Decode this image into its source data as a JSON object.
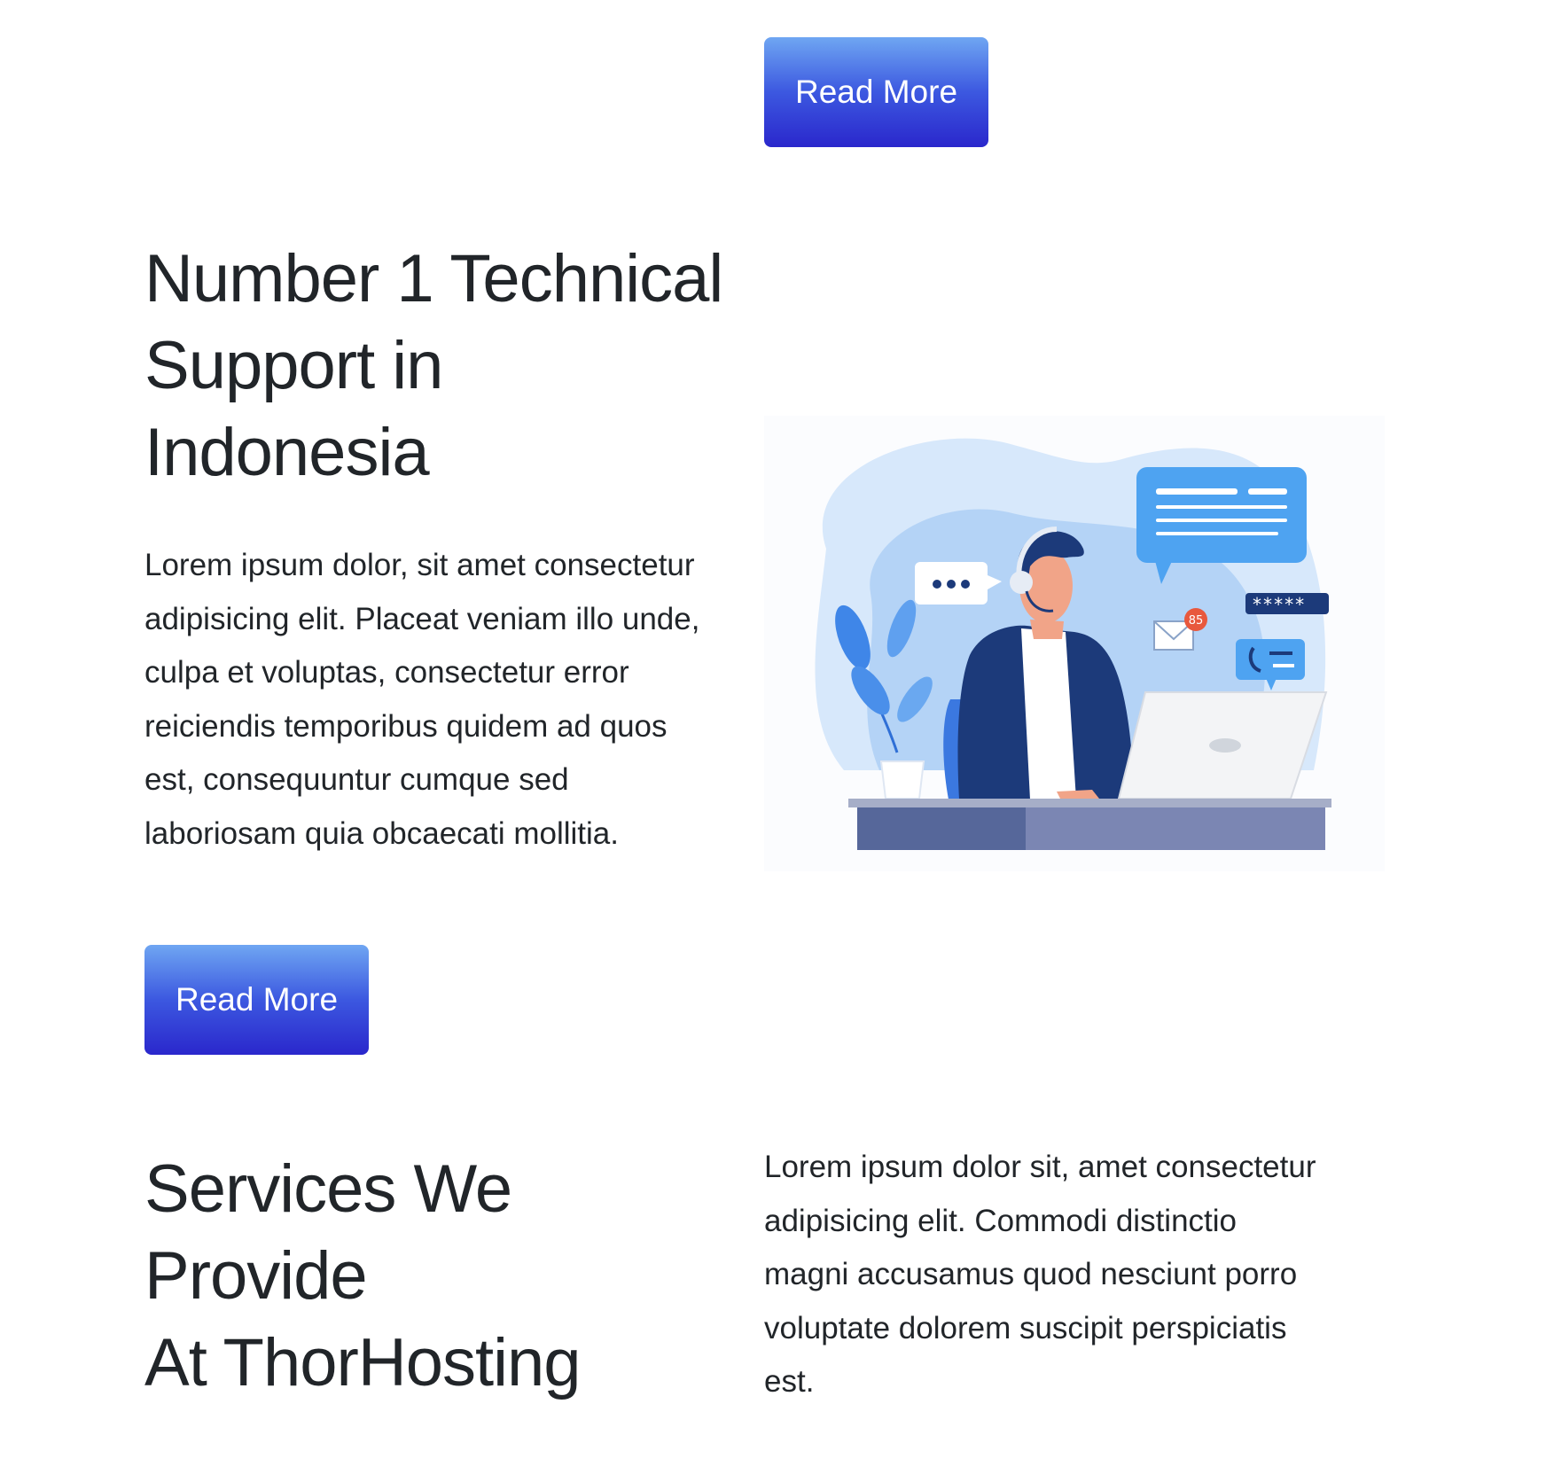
{
  "top_cta": {
    "label": "Read More"
  },
  "hero": {
    "title_lines": [
      "Number 1 Technical",
      "Support in",
      "Indonesia"
    ],
    "body_lines": [
      "Lorem ipsum dolor, sit amet consectetur",
      "adipisicing elit. Placeat veniam illo unde,",
      "culpa et voluptas, consectetur error",
      "reiciendis temporibus quidem ad quos",
      "est, consequuntur cumque sed",
      "laboriosam quia obcaecati mollitia."
    ],
    "cta_label": "Read More",
    "illustration": {
      "icon": "customer-support-agent-illustration",
      "badge_count": "85",
      "password_mask": "*****"
    }
  },
  "services": {
    "title_lines": [
      "Services We",
      "Provide",
      "At ThorHosting"
    ],
    "body_lines": [
      "Lorem ipsum dolor sit, amet consectetur",
      "adipisicing elit. Commodi distinctio",
      "magni accusamus quod nesciunt porro",
      "voluptate dolorem suscipit perspiciatis",
      "est."
    ]
  },
  "colors": {
    "button_gradient_top": "#6fa6f2",
    "button_gradient_bottom": "#2a27cc",
    "text": "#212529",
    "illustration_blob": "#d7e8fb",
    "agent_jacket": "#1c3a7a"
  }
}
